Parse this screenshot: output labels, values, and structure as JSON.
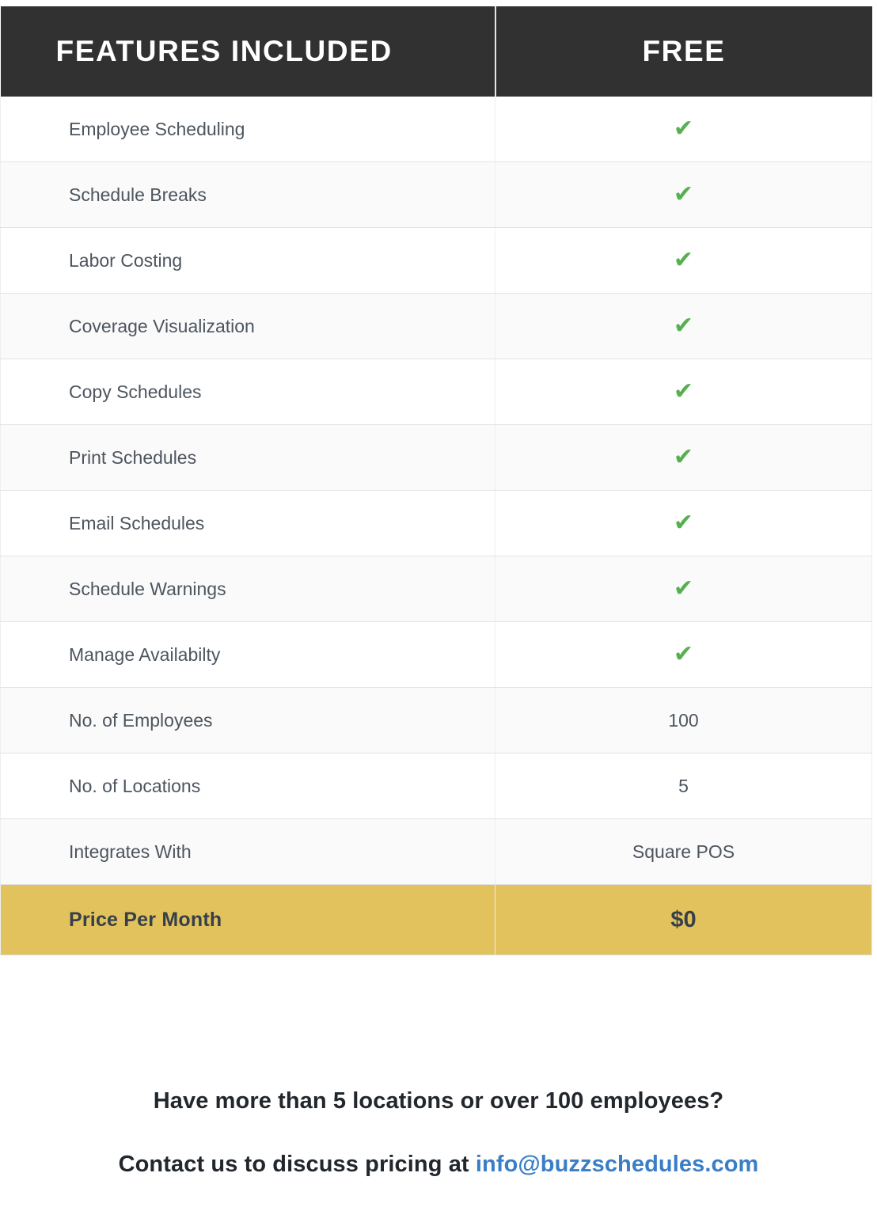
{
  "table": {
    "headers": {
      "feature_column": "FEATURES INCLUDED",
      "plan_column": "FREE"
    },
    "check_glyph": "✔",
    "rows": [
      {
        "feature": "Employee Scheduling",
        "value": "✔",
        "type": "check"
      },
      {
        "feature": "Schedule Breaks",
        "value": "✔",
        "type": "check"
      },
      {
        "feature": "Labor Costing",
        "value": "✔",
        "type": "check"
      },
      {
        "feature": "Coverage Visualization",
        "value": "✔",
        "type": "check"
      },
      {
        "feature": "Copy Schedules",
        "value": "✔",
        "type": "check"
      },
      {
        "feature": "Print Schedules",
        "value": "✔",
        "type": "check"
      },
      {
        "feature": "Email Schedules",
        "value": "✔",
        "type": "check"
      },
      {
        "feature": "Schedule Warnings",
        "value": "✔",
        "type": "check"
      },
      {
        "feature": "Manage Availabilty",
        "value": "✔",
        "type": "check"
      },
      {
        "feature": "No. of Employees",
        "value": "100",
        "type": "text"
      },
      {
        "feature": "No. of Locations",
        "value": "5",
        "type": "text"
      },
      {
        "feature": "Integrates With",
        "value": "Square POS",
        "type": "text"
      }
    ],
    "price_row": {
      "label": "Price Per Month",
      "value": "$0"
    }
  },
  "contact": {
    "question": "Have more than 5 locations or over 100 employees?",
    "prefix": "Contact us to discuss pricing at ",
    "email": "info@buzzschedules.com"
  },
  "colors": {
    "header_background": "#313131",
    "header_text": "#ffffff",
    "row_background_odd": "#ffffff",
    "row_background_even": "#fafafa",
    "row_text": "#4d555e",
    "row_border": "#e3e3e3",
    "check_green": "#56b050",
    "price_row_background": "#e1c25c",
    "price_row_text": "#37404a",
    "email_link": "#3a7ec6",
    "contact_text": "#22272d"
  }
}
